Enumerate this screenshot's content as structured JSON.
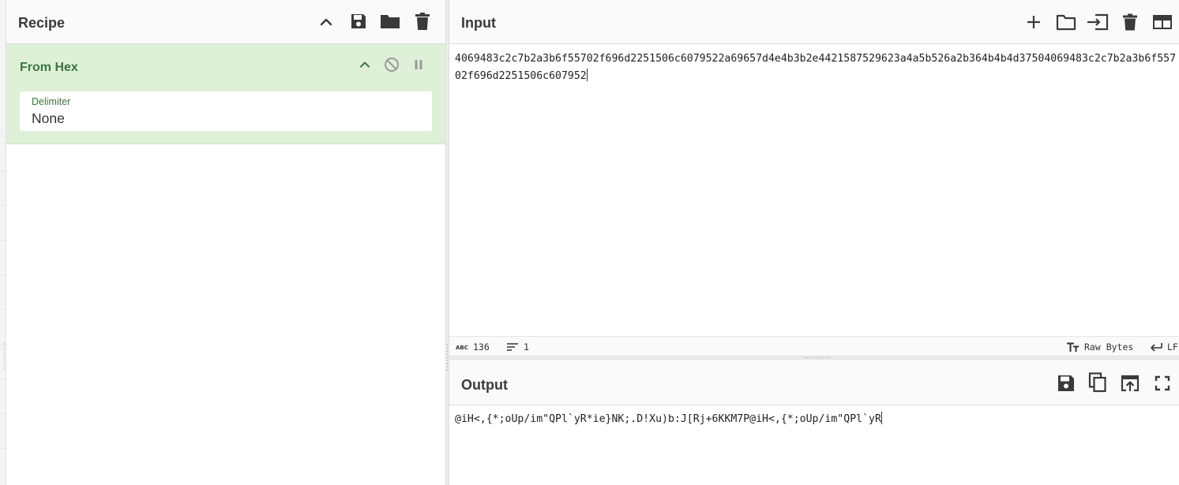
{
  "recipe": {
    "title": "Recipe",
    "operation": {
      "name": "From Hex",
      "argument_label": "Delimiter",
      "argument_value": "None"
    }
  },
  "input": {
    "title": "Input",
    "text": "4069483c2c7b2a3b6f55702f696d2251506c6079522a69657d4e4b3b2e4421587529623a4a5b526a2b364b4b4d37504069483c2c7b2a3b6f55702f696d2251506c607952",
    "status": {
      "length": "136",
      "lines": "1",
      "encoding": "Raw Bytes",
      "eol": "LF"
    }
  },
  "output": {
    "title": "Output",
    "text": "@iH<,{*;oUp/im\"QPl`yR*ie}NK;.D!Xu)b:J[Rj+6KKM7P@iH<,{*;oUp/im\"QPl`yR"
  },
  "colors": {
    "operation_background": "#dff0d8",
    "operation_text": "#3c763d",
    "icon": "#3a3a3a"
  }
}
